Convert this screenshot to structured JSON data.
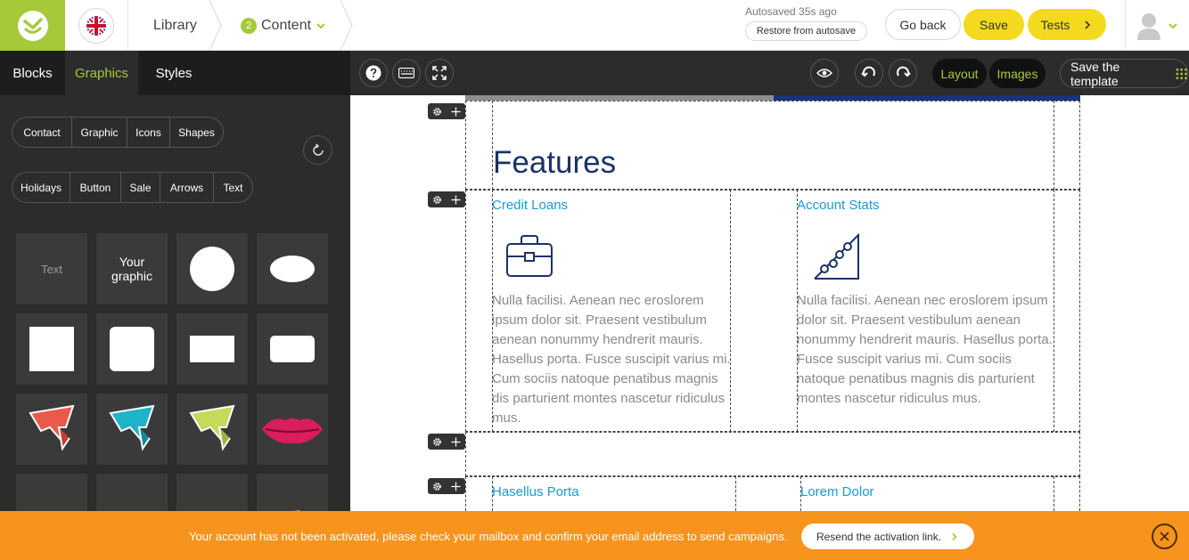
{
  "header": {
    "breadcrumb": {
      "library": "Library",
      "step_number": "2",
      "content": "Content"
    },
    "autosave_status": "Autosaved 35s ago",
    "restore_label": "Restore from autosave",
    "go_back_label": "Go back",
    "save_label": "Save",
    "tests_label": "Tests"
  },
  "panel": {
    "tabs": [
      "Blocks",
      "Graphics",
      "Styles"
    ],
    "active_tab": "Graphics",
    "chips_row1": [
      "Contact",
      "Graphic",
      "Icons",
      "Shapes"
    ],
    "chips_row2": [
      "Holidays",
      "Button",
      "Sale",
      "Arrows",
      "Text"
    ],
    "tiles": {
      "text_tile": "Text",
      "graphic_tile_line1": "Your",
      "graphic_tile_line2": "graphic"
    }
  },
  "toolbar": {
    "help_icon": "question-icon",
    "layout_label": "Layout",
    "images_label": "Images",
    "save_template_label": "Save the template"
  },
  "canvas": {
    "section_title": "Features",
    "columns": [
      {
        "title": "Credit Loans",
        "icon": "briefcase-icon",
        "body": "Nulla facilisi. Aenean nec eroslorem ipsum dolor sit. Praesent vestibulum aenean nonummy hendrerit mauris. Hasellus porta. Fusce suscipit varius mi. Cum sociis natoque penatibus magnis dis parturient montes nascetur ridiculus mus."
      },
      {
        "title": "Account Stats",
        "icon": "stats-chart-icon",
        "body": "Nulla facilisi. Aenean nec eroslorem ipsum dolor sit. Praesent vestibulum aenean nonummy hendrerit mauris. Hasellus porta. Fusce suscipit varius mi. Cum sociis natoque penatibus magnis dis parturient montes nascetur ridiculus mus."
      },
      {
        "title": "Hasellus Porta"
      },
      {
        "title": "Lorem Dolor"
      }
    ]
  },
  "notification": {
    "message": "Your account has not been activated, please check your mailbox and confirm your email address to send campaigns.",
    "resend_label": "Resend the activation link."
  },
  "colors": {
    "brand_green": "#a6c93a",
    "accent_yellow": "#f3da1e",
    "notification_orange": "#f7941d",
    "title_navy": "#1a3367",
    "link_blue": "#1a9ad6"
  }
}
